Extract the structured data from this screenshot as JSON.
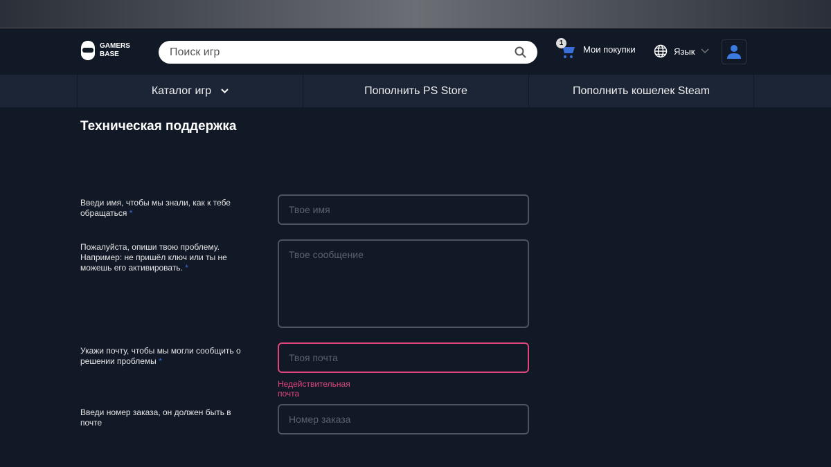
{
  "header": {
    "logo_line1": "GAMERS",
    "logo_line2": "BASE",
    "search_placeholder": "Поиск игр",
    "cart_count": "1",
    "cart_label": "Мои покупки",
    "lang_label": "Язык"
  },
  "nav": [
    {
      "label": "Каталог игр"
    },
    {
      "label": "Пополнить PS Store"
    },
    {
      "label": "Пополнить кошелек Steam"
    }
  ],
  "page_title": "Техническая поддержка",
  "form": {
    "name_label": "Введи имя, чтобы мы знали, как к тебе обращаться",
    "name_placeholder": "Твое имя",
    "message_label": "Пожалуйста, опиши твою проблему. Например: не пришёл ключ или ты не можешь его активировать.",
    "message_placeholder": "Твое сообщение",
    "email_label": "Укажи почту, чтобы мы могли сообщить о решении проблемы",
    "email_placeholder": "Твоя почта",
    "email_error": "Недействительная почта",
    "order_label": "Введи номер заказа, он должен быть в почте",
    "order_placeholder": "Номер заказа",
    "required_mark": "*"
  },
  "colors": {
    "accent": "#3b6fd8",
    "error": "#e0457b"
  }
}
